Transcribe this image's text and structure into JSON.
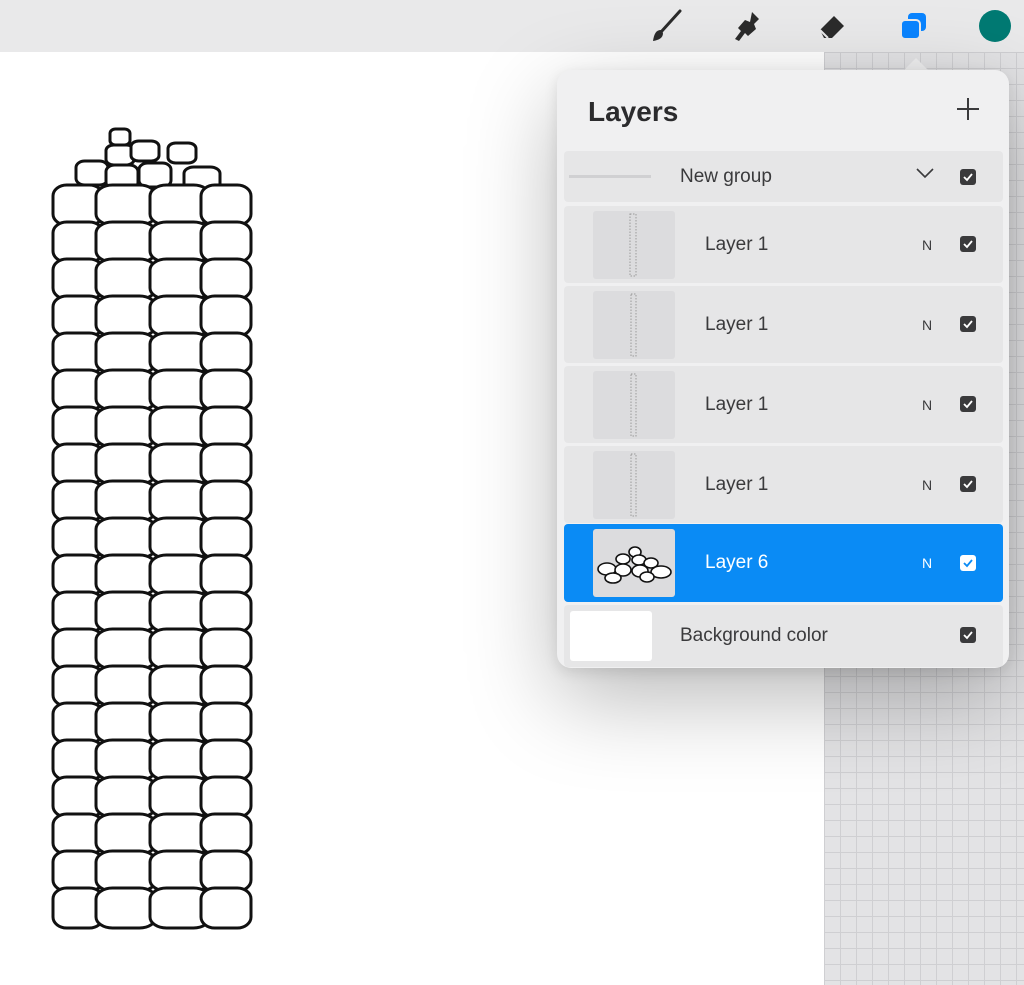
{
  "toolbar": {
    "tools": [
      {
        "icon": "brush-icon",
        "color": "#2b2b2b"
      },
      {
        "icon": "smudge-icon",
        "color": "#2b2b2b"
      },
      {
        "icon": "eraser-icon",
        "color": "#2b2b2b"
      },
      {
        "icon": "layers-icon",
        "color": "#0a84ff"
      }
    ],
    "current_color": "#007a73"
  },
  "layers_panel": {
    "title": "Layers",
    "add_icon": "plus-icon",
    "group": {
      "name": "New group",
      "icon": "chevron-down-icon",
      "visible": true
    },
    "layers": [
      {
        "name": "Layer 1",
        "blend": "N",
        "visible": true,
        "selected": false
      },
      {
        "name": "Layer 1",
        "blend": "N",
        "visible": true,
        "selected": false
      },
      {
        "name": "Layer 1",
        "blend": "N",
        "visible": true,
        "selected": false
      },
      {
        "name": "Layer 1",
        "blend": "N",
        "visible": true,
        "selected": false
      },
      {
        "name": "Layer 6",
        "blend": "N",
        "visible": true,
        "selected": true
      }
    ],
    "background": {
      "name": "Background color",
      "visible": true
    }
  },
  "colors": {
    "accent": "#0a8bf5",
    "panel_bg": "#f0f0f1",
    "row_bg": "#e6e6e7"
  }
}
